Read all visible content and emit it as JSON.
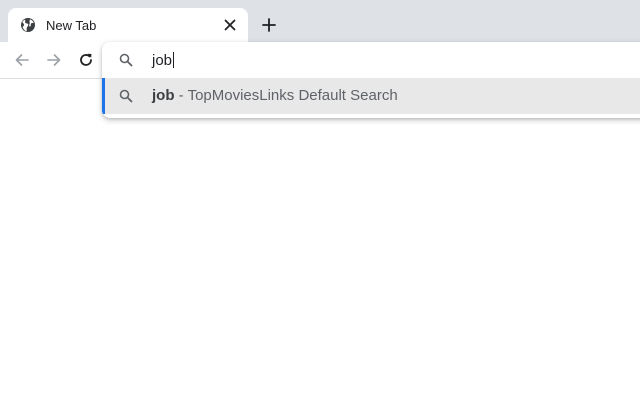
{
  "tab": {
    "title": "New Tab",
    "favicon": "globe-icon",
    "close_icon": "close-icon"
  },
  "new_tab_icon": "plus-icon",
  "toolbar": {
    "back_icon": "back-arrow-icon",
    "forward_icon": "forward-arrow-icon",
    "reload_icon": "reload-icon"
  },
  "omnibox": {
    "value": "job",
    "icon": "search-icon"
  },
  "suggestions": [
    {
      "icon": "search-icon",
      "query": "job",
      "separator": " - ",
      "description": "TopMoviesLinks Default Search",
      "selected": true
    }
  ],
  "colors": {
    "tabstrip": "#dee1e6",
    "accent": "#1a73e8",
    "selected_row": "#e8e8e9"
  }
}
